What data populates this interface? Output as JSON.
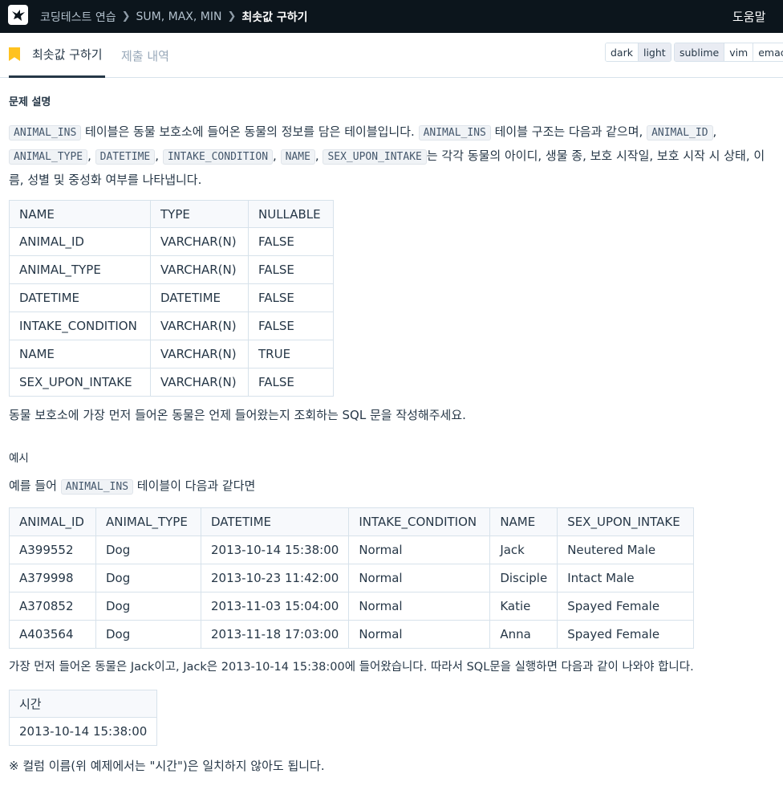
{
  "topbar": {
    "breadcrumbs": [
      "코딩테스트 연습",
      "SUM, MAX, MIN"
    ],
    "current": "최솟값 구하기",
    "help": "도움말"
  },
  "tabs": {
    "active": "최솟값 구하기",
    "inactive": "제출 내역"
  },
  "theme_options": [
    "dark",
    "light"
  ],
  "theme_selected": "light",
  "editor_options": [
    "sublime",
    "vim",
    "emacs"
  ],
  "editor_selected": "sublime",
  "problem": {
    "section_title": "문제 설명",
    "intro": {
      "c1": "ANIMAL_INS",
      "t1": " 테이블은 동물 보호소에 들어온 동물의 정보를 담은 테이블입니다. ",
      "c2": "ANIMAL_INS",
      "t2": " 테이블 구조는 다음과 같으며, ",
      "c3": "ANIMAL_ID",
      "t3": ", ",
      "c4": "ANIMAL_TYPE",
      "t4": ", ",
      "c5": "DATETIME",
      "t5": ", ",
      "c6": "INTAKE_CONDITION",
      "t6": ", ",
      "c7": "NAME",
      "t7": ", ",
      "c8": "SEX_UPON_INTAKE",
      "t8": "는 각각 동물의 아이디, 생물 종, 보호 시작일, 보호 시작 시 상태, 이름, 성별 및 중성화 여부를 나타냅니다."
    },
    "schema_table": {
      "headers": [
        "NAME",
        "TYPE",
        "NULLABLE"
      ],
      "rows": [
        [
          "ANIMAL_ID",
          "VARCHAR(N)",
          "FALSE"
        ],
        [
          "ANIMAL_TYPE",
          "VARCHAR(N)",
          "FALSE"
        ],
        [
          "DATETIME",
          "DATETIME",
          "FALSE"
        ],
        [
          "INTAKE_CONDITION",
          "VARCHAR(N)",
          "FALSE"
        ],
        [
          "NAME",
          "VARCHAR(N)",
          "TRUE"
        ],
        [
          "SEX_UPON_INTAKE",
          "VARCHAR(N)",
          "FALSE"
        ]
      ]
    },
    "task": "동물 보호소에 가장 먼저 들어온 동물은 언제 들어왔는지 조회하는 SQL 문을 작성해주세요.",
    "example_label": "예시",
    "example_intro": {
      "t1": "예를 들어 ",
      "c1": "ANIMAL_INS",
      "t2": " 테이블이 다음과 같다면"
    },
    "example_table": {
      "headers": [
        "ANIMAL_ID",
        "ANIMAL_TYPE",
        "DATETIME",
        "INTAKE_CONDITION",
        "NAME",
        "SEX_UPON_INTAKE"
      ],
      "rows": [
        [
          "A399552",
          "Dog",
          "2013-10-14 15:38:00",
          "Normal",
          "Jack",
          "Neutered Male"
        ],
        [
          "A379998",
          "Dog",
          "2013-10-23 11:42:00",
          "Normal",
          "Disciple",
          "Intact Male"
        ],
        [
          "A370852",
          "Dog",
          "2013-11-03 15:04:00",
          "Normal",
          "Katie",
          "Spayed Female"
        ],
        [
          "A403564",
          "Dog",
          "2013-11-18 17:03:00",
          "Normal",
          "Anna",
          "Spayed Female"
        ]
      ]
    },
    "result_text": "가장 먼저 들어온 동물은 Jack이고, Jack은 2013-10-14 15:38:00에 들어왔습니다. 따라서 SQL문을 실행하면 다음과 같이 나와야 합니다.",
    "result_table": {
      "headers": [
        "시간"
      ],
      "rows": [
        [
          "2013-10-14 15:38:00"
        ]
      ]
    },
    "note": "※ 컬럼 이름(위 예제에서는 \"시간\")은 일치하지 않아도 됩니다."
  }
}
